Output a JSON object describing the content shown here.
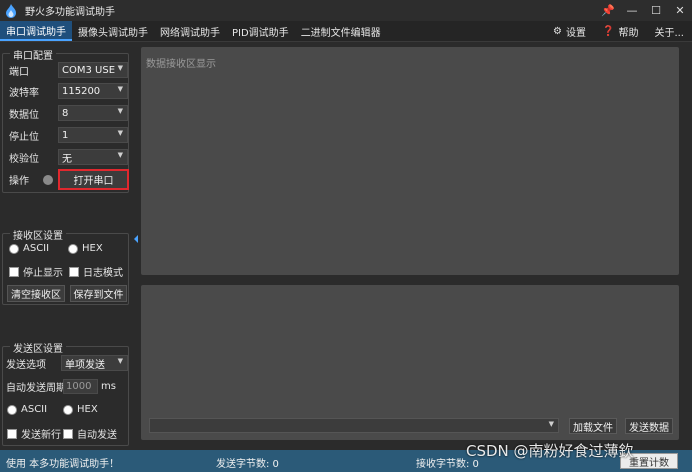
{
  "window": {
    "title": "野火多功能调试助手",
    "controls": [
      "📌",
      "—",
      "☐",
      "✕"
    ]
  },
  "tabs": [
    {
      "label": "串口调试助手",
      "active": true
    },
    {
      "label": "摄像头调试助手"
    },
    {
      "label": "网络调试助手"
    },
    {
      "label": "PID调试助手"
    },
    {
      "label": "二进制文件编辑器"
    }
  ],
  "tab_buttons": {
    "settings": "设置",
    "help": "帮助",
    "about": "关于..."
  },
  "serial_config": {
    "title": "串口配置",
    "port_label": "端口",
    "port_value": "COM3 USE",
    "baud_label": "波特率",
    "baud_value": "115200",
    "databits_label": "数据位",
    "databits_value": "8",
    "stopbits_label": "停止位",
    "stopbits_value": "1",
    "parity_label": "校验位",
    "parity_value": "无",
    "op_label": "操作",
    "open_button": "打开串口"
  },
  "recv_settings": {
    "title": "接收区设置",
    "ascii": "ASCII",
    "hex": "HEX",
    "stop_display": "停止显示",
    "log_mode": "日志模式",
    "clear_button": "清空接收区",
    "save_button": "保存到文件"
  },
  "send_settings": {
    "title": "发送区设置",
    "option_label": "发送选项",
    "option_value": "单项发送",
    "auto_period_label": "自动发送周期",
    "auto_period_value": "1000",
    "unit": "ms",
    "ascii": "ASCII",
    "hex": "HEX",
    "send_newline": "发送新行",
    "auto_send": "自动发送"
  },
  "recv_area": {
    "placeholder": "数据接收区显示"
  },
  "send_area": {
    "load_file": "加载文件",
    "send_data": "发送数据"
  },
  "status": {
    "welcome": "使用 本多功能调试助手！",
    "sent_bytes": "发送字节数: 0",
    "recv_bytes": "接收字节数: 0",
    "button": "重置计数"
  },
  "watermark": "CSDN @南粉好食过薄欽",
  "colors": {
    "accent": "#1f4f7c",
    "highlight_box": "#e0282e",
    "status_bar": "#2b5a78"
  }
}
